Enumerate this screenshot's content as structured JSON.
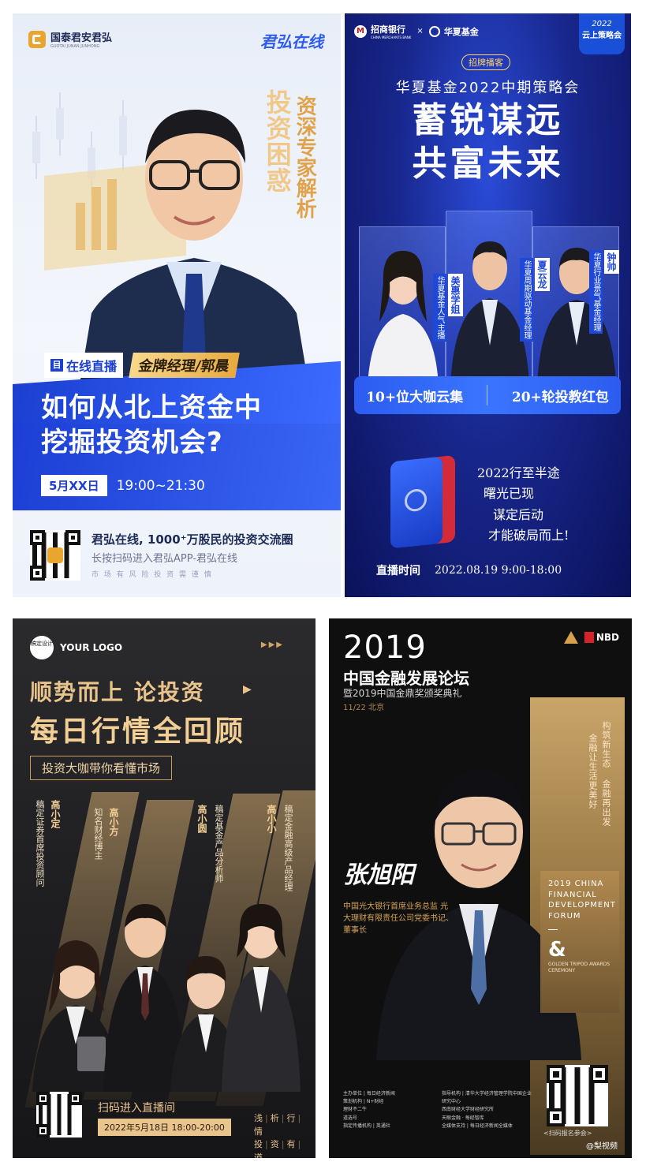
{
  "panel1": {
    "logo_left": "国泰君安君弘",
    "logo_left_sub": "GUOTAI JUNAN JUNHONG",
    "logo_right": "君弘在线",
    "vertical_big": "投资困惑",
    "vertical_small": "资深专家解析",
    "badge_live": "在线直播",
    "manager": "金牌经理/郭晨",
    "title_line1": "如何从北上资金中",
    "title_line2": "挖掘投资机会?",
    "date": "5月XX日",
    "time": "19:00~21:30",
    "footer_main": "君弘在线, 1000⁺万股民的投资交流圈",
    "footer_sub": "长按扫码进入君弘APP-君弘在线",
    "footer_tiny": "市 场 有 风 险   投 资 需 谨 慎",
    "accent": "#2f5cf0",
    "gold": "#d9a441"
  },
  "panel2": {
    "bank_logo": "招商银行",
    "bank_logo_sub": "CHINA MERCHANTS BANK",
    "partner_logo": "华夏基金",
    "badge_year": "2022",
    "badge_text": "云上策略会",
    "tag": "招牌播客",
    "subtitle": "华夏基金2022中期策略会",
    "title_line1": "蓄锐谋远",
    "title_line2": "共富未来",
    "speakers": [
      {
        "name": "美惠学姐",
        "role": "华夏基金人气主播"
      },
      {
        "name": "夏云龙",
        "role": "华夏周期驱动基金经理"
      },
      {
        "name": "钟帅",
        "role": "华夏行业景气基金经理"
      }
    ],
    "stat_left": "10+位大咖云集",
    "stat_right": "20+轮投教红包",
    "slogan": [
      "2022行至半途",
      "曙光已现",
      "谋定后动",
      "才能破局而上!"
    ],
    "live_label": "直播时间",
    "live_time": "2022.08.19  9:00-18:00"
  },
  "panel3": {
    "logo_mark": "稿定设计",
    "logo_text": "YOUR LOGO",
    "arrows": "▶▶▶",
    "title_line1": "顺势而上 论投资",
    "title_line2": "每日行情全回顾",
    "subtitle": "投资大咖带你看懂市场",
    "people": [
      {
        "name": "高小定",
        "role": "稿定证券首席投资顾问"
      },
      {
        "name": "高小方",
        "role": "知名财经博主"
      },
      {
        "name": "高小圆",
        "role": "稿定基金产品分析师"
      },
      {
        "name": "高小小",
        "role": "稿定金融高级产品经理"
      }
    ],
    "cta": "扫码进入直播间",
    "date_time": "2022年5月18日 18:00-20:00",
    "motto": [
      "浅",
      "析",
      "行",
      "情",
      "投",
      "资",
      "有",
      "道"
    ]
  },
  "panel4": {
    "year": "2019",
    "title": "中国金融发展论坛",
    "subtitle": "暨2019中国金鼎奖颁奖典礼",
    "date_place": "11/22  北京",
    "logo_nbd": "NBD",
    "vertical_quote_1": "构筑新生态 金融再出发",
    "vertical_quote_2": "金融让生活更美好",
    "signature": "张旭阳",
    "speaker_role": "中国光大银行首席业务总监 光大理财有限责任公司党委书记、董事长",
    "en_title": "2019 CHINA FINANCIAL DEVELOPMENT FORUM",
    "amp": "&",
    "en_sub": "GOLDEN TRIPOD AWARDS CEREMONY",
    "credits": [
      "主办单位 | 每日经济新闻",
      "策划机构 | N+财经",
      "理财不二牛",
      "道选号",
      "指导机构 | 清华大学经济管理学院中国企业研究中心",
      "西南财经大学财经研究所",
      "天眼金融 · 每经智库",
      "指定传播机构 | 英通社",
      "全媒体支持 | 每日经济新闻全媒体"
    ],
    "qr_caption": "<扫码报名参会>",
    "watermark": "@梨视频"
  }
}
